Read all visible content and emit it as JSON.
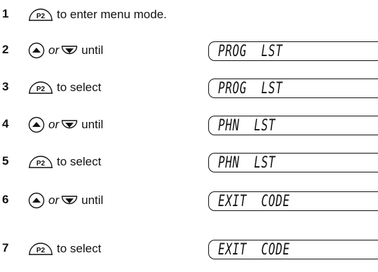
{
  "steps": [
    {
      "number": "1",
      "button": "P2",
      "text": "to enter menu mode.",
      "display": null
    },
    {
      "number": "2",
      "button": "up-down",
      "or": "or",
      "text": "until",
      "display": "PROG  LST"
    },
    {
      "number": "3",
      "button": "P2",
      "text": "to select",
      "display": "PROG  LST"
    },
    {
      "number": "4",
      "button": "up-down",
      "or": "or",
      "text": "until",
      "display": "PHN  LST"
    },
    {
      "number": "5",
      "button": "P2",
      "text": "to select",
      "display": "PHN  LST"
    },
    {
      "number": "6",
      "button": "up-down",
      "or": "or",
      "text": "until",
      "display": "EXIT  CODE"
    },
    {
      "number": "7",
      "button": "P2",
      "text": "to select",
      "display": "EXIT  CODE"
    }
  ],
  "icons": {
    "p2_key_label": "P2",
    "up_arrow": "up-arrow-key-icon",
    "down_arrow": "down-arrow-key-icon"
  }
}
